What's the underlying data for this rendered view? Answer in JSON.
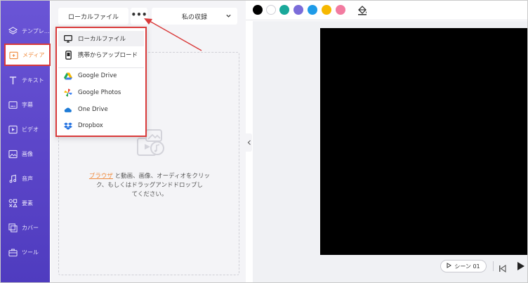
{
  "sidebar": {
    "items": [
      {
        "label": "テンプレ…",
        "icon": "layers-icon"
      },
      {
        "label": "メディア",
        "icon": "media-folder-icon"
      },
      {
        "label": "テキスト",
        "icon": "text-icon"
      },
      {
        "label": "字幕",
        "icon": "subtitle-icon"
      },
      {
        "label": "ビデオ",
        "icon": "video-icon"
      },
      {
        "label": "画像",
        "icon": "image-icon"
      },
      {
        "label": "音声",
        "icon": "music-icon"
      },
      {
        "label": "要素",
        "icon": "elements-icon"
      },
      {
        "label": "カバー",
        "icon": "cover-icon"
      },
      {
        "label": "ツール",
        "icon": "toolbox-icon"
      }
    ],
    "active_index": 1
  },
  "panel": {
    "local_tab": "ローカルファイル",
    "more_label": "•••",
    "collection_label": "私の収録",
    "drop_link": "ブラウザ",
    "drop_text_1": "と動画、画像、オーディオをクリッ",
    "drop_text_2": "ク、もしくはドラッグアンドドロップし",
    "drop_text_3": "てください。"
  },
  "menu": {
    "items": [
      {
        "label": "ローカルファイル",
        "icon": "monitor-icon"
      },
      {
        "label": "携帯からアップロード",
        "icon": "phone-icon"
      },
      {
        "label": "Google Drive",
        "icon": "google-drive-icon"
      },
      {
        "label": "Google Photos",
        "icon": "google-photos-icon"
      },
      {
        "label": "One Drive",
        "icon": "onedrive-icon"
      },
      {
        "label": "Dropbox",
        "icon": "dropbox-icon"
      }
    ]
  },
  "colors": {
    "swatches": [
      "#000000",
      "#ffffff",
      "#19a89a",
      "#7b6cd9",
      "#1e9be8",
      "#f6b800",
      "#f27ba0"
    ],
    "accent": "#6a55d6",
    "highlight": "#d93a3a"
  },
  "player": {
    "scene_label": "シーン 01"
  }
}
